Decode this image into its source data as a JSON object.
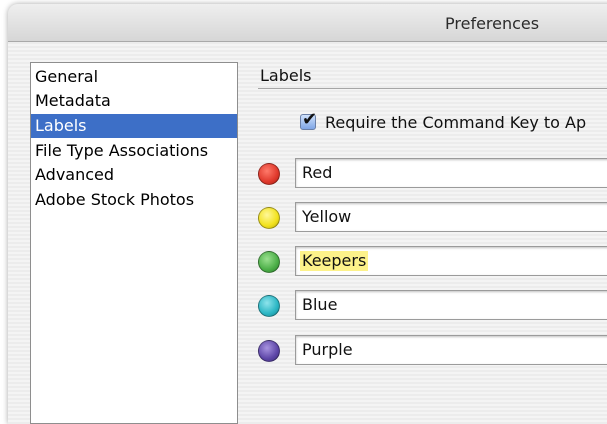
{
  "window": {
    "title": "Preferences"
  },
  "sidebar": {
    "items": [
      {
        "label": "General",
        "selected": false
      },
      {
        "label": "Metadata",
        "selected": false
      },
      {
        "label": "Labels",
        "selected": true
      },
      {
        "label": "File Type Associations",
        "selected": false
      },
      {
        "label": "Advanced",
        "selected": false
      },
      {
        "label": "Adobe Stock Photos",
        "selected": false
      }
    ]
  },
  "labels_panel": {
    "section_title": "Labels",
    "require_command_key": {
      "label": "Require the Command Key to Ap",
      "checked": true
    },
    "labels": [
      {
        "name": "Red",
        "color": "#e0392c",
        "color_icon": "red-dot-icon",
        "highlighted": false
      },
      {
        "name": "Yellow",
        "color": "#f2e21d",
        "color_icon": "yellow-dot-icon",
        "highlighted": false
      },
      {
        "name": "Keepers",
        "color": "#4caf48",
        "color_icon": "green-dot-icon",
        "highlighted": true
      },
      {
        "name": "Blue",
        "color": "#2bb6c4",
        "color_icon": "blue-dot-icon",
        "highlighted": false
      },
      {
        "name": "Purple",
        "color": "#5e47a8",
        "color_icon": "purple-dot-icon",
        "highlighted": false
      }
    ]
  },
  "colors": {
    "selection": "#3d6fc7",
    "highlight": "#fdf28a"
  }
}
